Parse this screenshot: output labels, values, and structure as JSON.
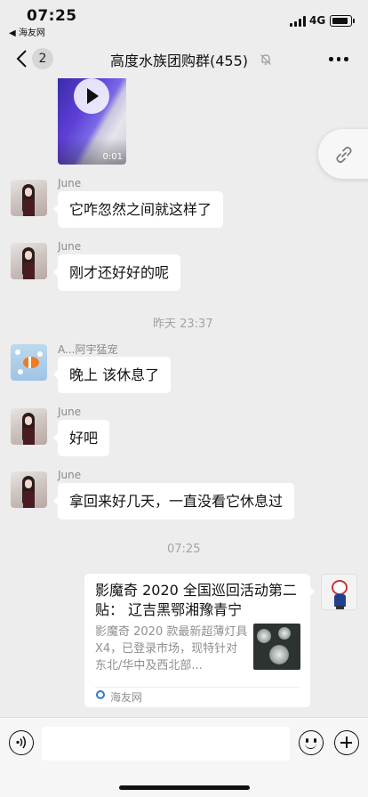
{
  "status_bar": {
    "time": "07:25",
    "back_app": "◀ 海友网",
    "network": "4G",
    "icons": [
      "signal-icon",
      "battery-icon"
    ]
  },
  "nav": {
    "unread_count": "2",
    "title": "高度水族团购群(455)",
    "icons": [
      "back-chevron-icon",
      "mute-bell-icon",
      "more-dots-icon"
    ]
  },
  "video_message": {
    "duration": "0:01"
  },
  "messages": [
    {
      "sender": "June",
      "text": "它咋忽然之间就这样了"
    },
    {
      "sender": "June",
      "text": "刚才还好好的呢"
    },
    {
      "sender": "A...阿宇猛宠",
      "text": "晚上 该休息了"
    },
    {
      "sender": "June",
      "text": "好吧"
    },
    {
      "sender": "June",
      "text": "拿回来好几天，一直没看它休息过"
    }
  ],
  "timestamps": [
    "昨天 23:37",
    "07:25"
  ],
  "link_card": {
    "title": "影魔奇 2020 全国巡回活动第二贴：  辽吉黑鄂湘豫青宁",
    "description": "影魔奇 2020 款最新超薄灯具 X4，已登录市场，现特针对东北/华中及西北部...",
    "source": "海友网"
  },
  "input_bar": {
    "placeholder": "",
    "icons": [
      "voice-icon",
      "emoji-icon",
      "plus-icon"
    ]
  }
}
